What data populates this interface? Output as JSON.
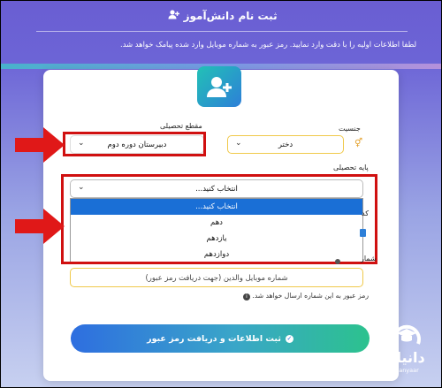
{
  "header": {
    "title": "ثبت نام دانش‌آموز",
    "intro": "لطفا اطلاعات اولیه را با دقت وارد نمایید. رمز عبور به شماره موبایل وارد شده پیامک خواهد شد."
  },
  "form": {
    "gender_label": "جنسیت",
    "gender_value": "دختر",
    "level_label": "مقطع تحصیلی",
    "level_value": "دبیرستان دوره دوم",
    "grade_label": "پایه تحصیلی",
    "grade_value": "انتخاب کنید...",
    "grade_options": [
      "انتخاب کنید...",
      "دهم",
      "یازدهم",
      "دوازدهم"
    ],
    "cut_label_code": "کد",
    "cut_label_phone": "شمار",
    "phone_placeholder": "شماره موبایل والدین (جهت دریافت رمز عبور)",
    "phone_hint": "رمز عبور به این شماره ارسال خواهد شد.",
    "submit_label": "ثبت اطلاعات و دریافت رمز عبور"
  },
  "watermark": {
    "logo_text": "دانیار",
    "logo_sub": "Danyaar"
  },
  "colors": {
    "annotation_red": "#d01010",
    "accent_yellow": "#f0c94a",
    "selected_blue": "#1a6fd6"
  }
}
